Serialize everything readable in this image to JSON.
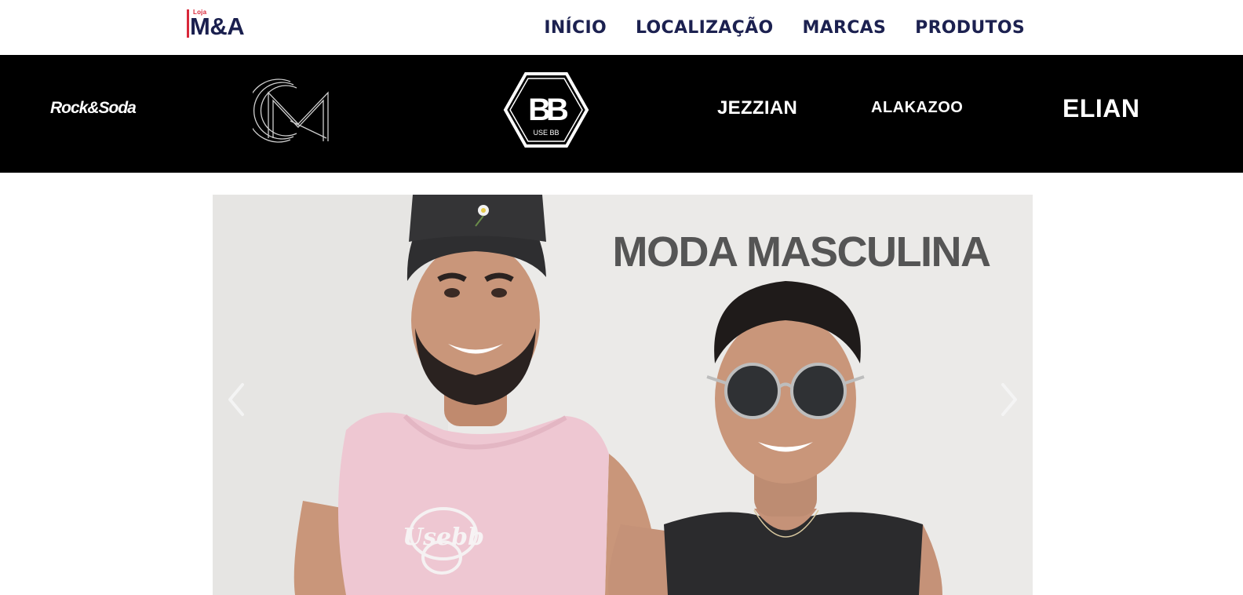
{
  "header": {
    "logo": {
      "small": "Loja",
      "main": "M&A"
    },
    "nav": [
      {
        "label": "INÍCIO"
      },
      {
        "label": "LOCALIZAÇÃO"
      },
      {
        "label": "MARCAS"
      },
      {
        "label": "PRODUTOS"
      }
    ]
  },
  "brands": {
    "rock_soda": "Rock&Soda",
    "cm_icon": "cm-monogram-logo",
    "bb": {
      "letters": "BB",
      "caption": "USE BB"
    },
    "jezzian": "JEZZIAN",
    "alakazoo": "ALAKAZOO",
    "elian": "ELIAN"
  },
  "hero": {
    "title": "MODA MASCULINA",
    "shirt_print": "Usebb",
    "prev_icon": "chevron-left-icon",
    "next_icon": "chevron-right-icon"
  },
  "colors": {
    "navy": "#1c2150",
    "accent_red": "#d9283a",
    "brand_bar": "#000000",
    "hero_bg": "#e9e8e6"
  }
}
